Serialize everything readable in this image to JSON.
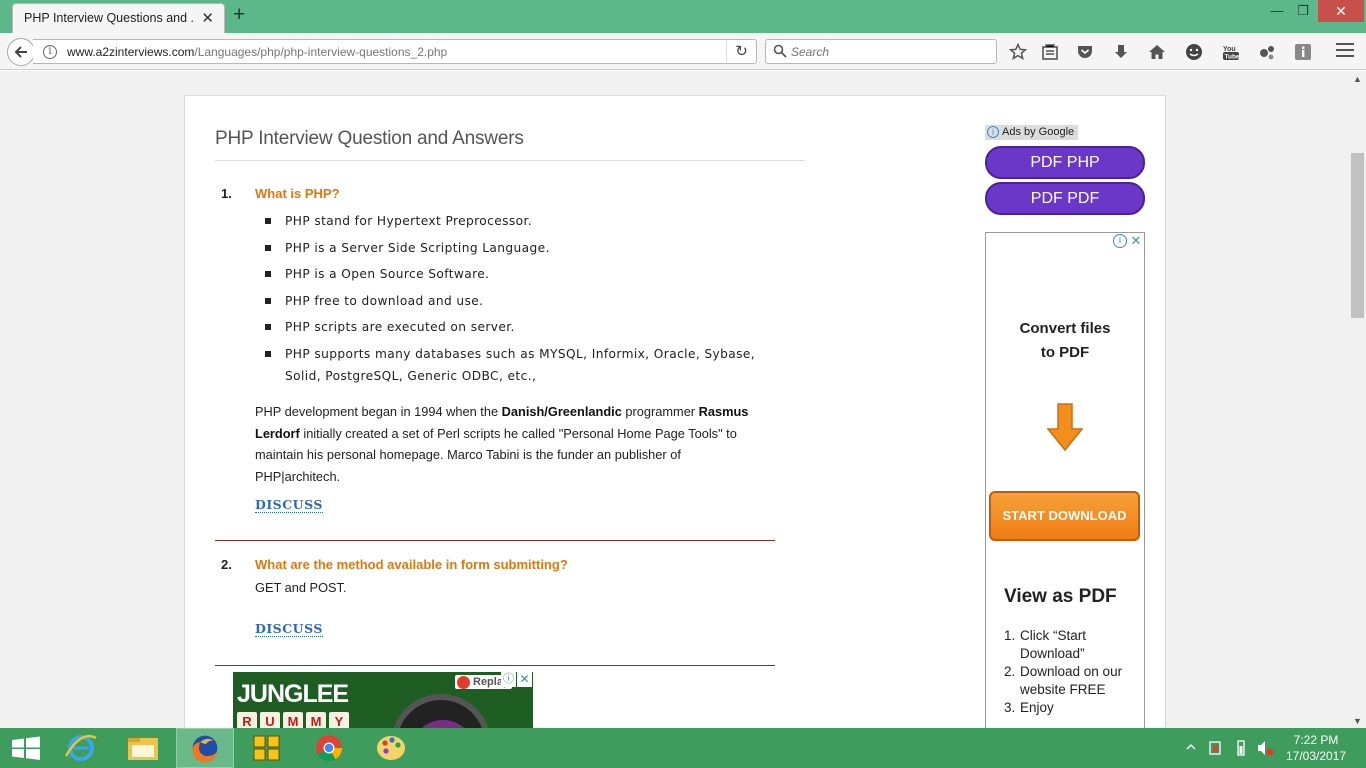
{
  "browser": {
    "tab_title": "PHP Interview Questions and ...",
    "tab_close": "✕",
    "new_tab": "+",
    "url_host": "www.a2zinterviews.com",
    "url_path": "/Languages/php/php-interview-questions_2.php",
    "search_placeholder": "Search",
    "window_min": "—",
    "window_max": "❐",
    "window_close": "✕"
  },
  "page": {
    "title": "PHP Interview Question and Answers",
    "questions": [
      {
        "number": "1.",
        "title": "What is PHP?",
        "points": [
          "PHP stand for Hypertext Preprocessor.",
          "PHP is a Server Side Scripting Language.",
          "PHP is a Open Source Software.",
          "PHP free to download and use.",
          "PHP scripts are executed on server.",
          "PHP supports many databases such as MYSQL, Informix, Oracle, Sybase, Solid, PostgreSQL, Generic ODBC, etc.,"
        ],
        "desc_1": "PHP development began in 1994 when the ",
        "desc_bold_1": "Danish/Greenlandic",
        "desc_2": " programmer ",
        "desc_bold_2": "Rasmus Lerdorf",
        "desc_3": " initially created a set of Perl scripts he called \"Personal Home Page Tools\" to maintain his personal homepage. Marco Tabini is the funder an publisher of PHP|architech.",
        "discuss": "DISCUSS"
      },
      {
        "number": "2.",
        "title": "What are the method available in form submitting?",
        "answer": "GET and POST.",
        "discuss": "DISCUSS"
      }
    ]
  },
  "ads": {
    "ads_by_google": "Ads by Google",
    "pdf_php": "PDF PHP",
    "pdf_pdf": "PDF PDF",
    "convert_line1": "Convert files",
    "convert_line2": "to PDF",
    "start_download": "START DOWNLOAD",
    "view_title": "View as PDF",
    "steps": [
      {
        "n": "1.",
        "text": "Click “Start Download”"
      },
      {
        "n": "2.",
        "text": "Download on our website FREE"
      },
      {
        "n": "3.",
        "text": "Enjoy"
      }
    ],
    "bottom_ad": {
      "brand": "JUNGLEE",
      "rummy_letters": [
        "R",
        "U",
        "M",
        "M",
        "Y"
      ],
      "replay": "Replay"
    }
  },
  "taskbar": {
    "time": "7:22 PM",
    "date": "17/03/2017"
  },
  "colors": {
    "titlebar": "#5cb88a",
    "question_title": "#e0770d",
    "discuss_link": "#2d67c7",
    "pdf_button": "#6a37c9",
    "taskbar": "#3e9c5c"
  }
}
